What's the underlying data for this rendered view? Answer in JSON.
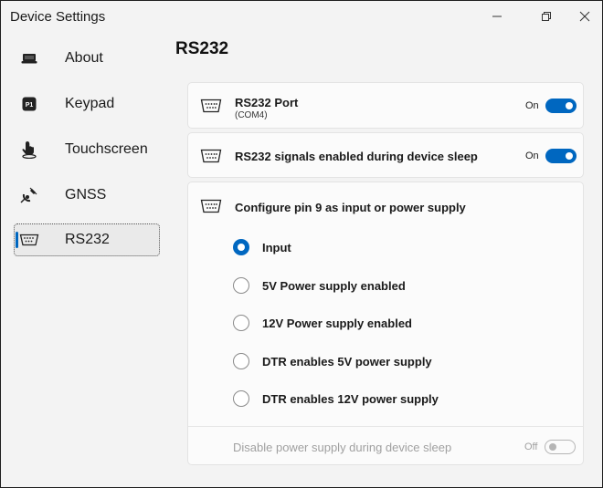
{
  "window": {
    "title": "Device Settings",
    "minimize_icon": "minimize-icon",
    "restore_icon": "restore-icon",
    "close_icon": "close-icon"
  },
  "sidebar": {
    "items": [
      {
        "label": "About",
        "icon": "about-icon",
        "active": false
      },
      {
        "label": "Keypad",
        "icon": "keypad-icon",
        "active": false
      },
      {
        "label": "Touchscreen",
        "icon": "touchscreen-icon",
        "active": false
      },
      {
        "label": "GNSS",
        "icon": "gnss-satellite-icon",
        "active": false
      },
      {
        "label": "RS232",
        "icon": "serial-port-icon",
        "active": true
      }
    ]
  },
  "main": {
    "title": "RS232",
    "port": {
      "label": "RS232 Port",
      "sublabel": "(COM4)",
      "state": "On",
      "enabled": true
    },
    "signals": {
      "label": "RS232 signals enabled during device sleep",
      "state": "On",
      "enabled": true
    },
    "pin9": {
      "label": "Configure pin 9 as input or power supply",
      "options": [
        {
          "label": "Input",
          "checked": true
        },
        {
          "label": "5V Power supply enabled",
          "checked": false
        },
        {
          "label": "12V Power supply enabled",
          "checked": false
        },
        {
          "label": "DTR enables 5V power supply",
          "checked": false
        },
        {
          "label": "DTR enables 12V power supply",
          "checked": false
        }
      ],
      "disable_sleep": {
        "label": "Disable power supply during device sleep",
        "state": "Off",
        "enabled": false
      }
    }
  },
  "colors": {
    "accent": "#0067c0",
    "background": "#f3f3f3",
    "card": "#fbfbfb"
  }
}
